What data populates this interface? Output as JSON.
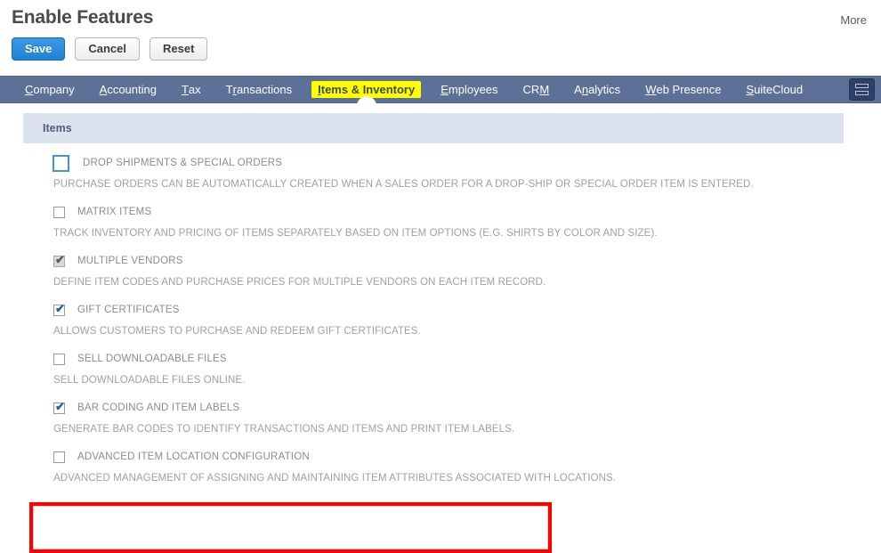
{
  "header": {
    "title": "Enable Features",
    "more_label": "More",
    "buttons": [
      {
        "label": "Save",
        "name": "save-button",
        "style": "primary"
      },
      {
        "label": "Cancel",
        "name": "cancel-button",
        "style": "secondary"
      },
      {
        "label": "Reset",
        "name": "reset-button",
        "style": "secondary"
      }
    ]
  },
  "tabs": [
    {
      "label": "Company",
      "accesskey": "C",
      "active": false
    },
    {
      "label": "Accounting",
      "accesskey": "A",
      "active": false
    },
    {
      "label": "Tax",
      "accesskey": "T",
      "active": false
    },
    {
      "label": "Transactions",
      "accesskey": "r",
      "active": false
    },
    {
      "label": "Items & Inventory",
      "accesskey": "I",
      "active": true
    },
    {
      "label": "Employees",
      "accesskey": "E",
      "active": false
    },
    {
      "label": "CRM",
      "accesskey": "M",
      "active": false
    },
    {
      "label": "Analytics",
      "accesskey": "n",
      "active": false
    },
    {
      "label": "Web Presence",
      "accesskey": "W",
      "active": false
    },
    {
      "label": "SuiteCloud",
      "accesskey": "S",
      "active": false
    }
  ],
  "panel_toggle": {
    "name": "panel-layout-toggle-icon"
  },
  "section": {
    "title": "Items"
  },
  "features": [
    {
      "label": "DROP SHIPMENTS & SPECIAL ORDERS",
      "description": "PURCHASE ORDERS CAN BE AUTOMATICALLY CREATED WHEN A SALES ORDER FOR A DROP-SHIP OR SPECIAL ORDER ITEM IS ENTERED.",
      "checked": false,
      "disabled": false,
      "focused": true,
      "highlighted": false
    },
    {
      "label": "MATRIX ITEMS",
      "description": "TRACK INVENTORY AND PRICING OF ITEMS SEPARATELY BASED ON ITEM OPTIONS (E.G. SHIRTS BY COLOR AND SIZE).",
      "checked": false,
      "disabled": false,
      "focused": false,
      "highlighted": false
    },
    {
      "label": "MULTIPLE VENDORS",
      "description": "DEFINE ITEM CODES AND PURCHASE PRICES FOR MULTIPLE VENDORS ON EACH ITEM RECORD.",
      "checked": true,
      "disabled": true,
      "focused": false,
      "highlighted": false
    },
    {
      "label": "GIFT CERTIFICATES",
      "description": "ALLOWS CUSTOMERS TO PURCHASE AND REDEEM GIFT CERTIFICATES.",
      "checked": true,
      "disabled": false,
      "focused": false,
      "highlighted": false
    },
    {
      "label": "SELL DOWNLOADABLE FILES",
      "description": "SELL DOWNLOADABLE FILES ONLINE.",
      "checked": false,
      "disabled": false,
      "focused": false,
      "highlighted": false
    },
    {
      "label": "BAR CODING AND ITEM LABELS",
      "description": "GENERATE BAR CODES TO IDENTIFY TRANSACTIONS AND ITEMS AND PRINT ITEM LABELS.",
      "checked": true,
      "disabled": false,
      "focused": false,
      "highlighted": true
    },
    {
      "label": "ADVANCED ITEM LOCATION CONFIGURATION",
      "description": "ADVANCED MANAGEMENT OF ASSIGNING AND MAINTAINING ITEM ATTRIBUTES ASSOCIATED WITH LOCATIONS.",
      "checked": false,
      "disabled": false,
      "focused": false,
      "highlighted": false
    }
  ],
  "colors": {
    "tab_bar": "#5d7198",
    "active_tab_bg": "#ffff00",
    "active_tab_text": "#3f4a33",
    "section_bar": "#dde3ee",
    "primary_button": "#1e82d2",
    "highlight_border": "#ff0000",
    "label_text": "#8c8c8c",
    "checkbox_check": "#1f5fa9"
  }
}
